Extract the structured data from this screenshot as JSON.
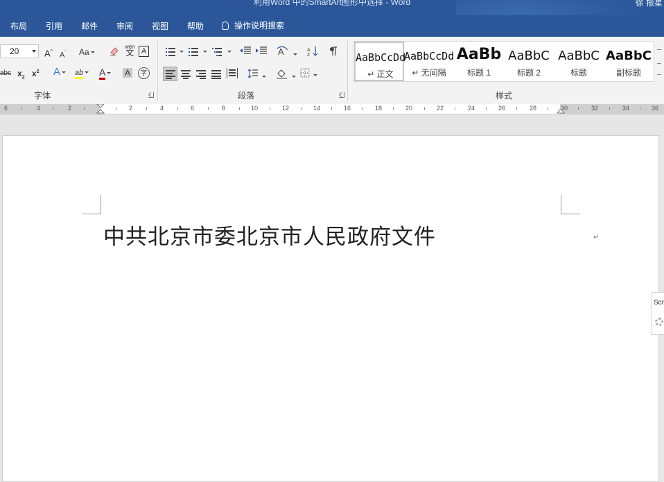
{
  "window": {
    "title": "利用Word 中的SmartArt图形中选择  -  Word",
    "user": "徐 振星"
  },
  "menu": {
    "tabs": [
      "布局",
      "引用",
      "邮件",
      "审阅",
      "视图",
      "帮助"
    ],
    "tell_me": "操作说明搜索"
  },
  "font_group": {
    "font_size": "20",
    "grow_label": "A",
    "shrink_label": "A",
    "case_label": "Aa",
    "phonetic_label": "wén",
    "border_label": "A",
    "strike_label": "abc",
    "subscript_label": "x",
    "superscript_label": "x",
    "effects_label": "A",
    "highlight_label": "ab",
    "font_color_label": "A",
    "shading_label": "A",
    "enclose_label": "字",
    "group_label": "字体"
  },
  "paragraph_group": {
    "group_label": "段落"
  },
  "styles_group": {
    "group_label": "样式",
    "items": [
      {
        "sample": "AaBbCcDd",
        "label": "↵ 正文",
        "selected": true
      },
      {
        "sample": "AaBbCcDd",
        "label": "↵ 无间隔",
        "selected": false
      },
      {
        "sample": "AaBb",
        "label": "标题 1",
        "selected": false
      },
      {
        "sample": "AaBbC",
        "label": "标题 2",
        "selected": false
      },
      {
        "sample": "AaBbC",
        "label": "标题",
        "selected": false
      },
      {
        "sample": "AaBbC",
        "label": "副标题",
        "selected": false
      }
    ]
  },
  "ruler": {
    "left_numbers": [
      "6",
      "4",
      "2"
    ],
    "right_numbers": [
      "2",
      "4",
      "6",
      "8",
      "10",
      "12",
      "14",
      "16",
      "18",
      "20",
      "22",
      "24",
      "26",
      "28",
      "30",
      "32",
      "34",
      "36"
    ]
  },
  "document": {
    "title_text": "中共北京市委北京市人民政府文件",
    "paragraph_mark": "↵"
  },
  "side_widget": {
    "label": "Scr"
  },
  "colors": {
    "ribbon_blue": "#2b579a",
    "highlight_yellow": "#ffff00",
    "font_red": "#c00000"
  }
}
